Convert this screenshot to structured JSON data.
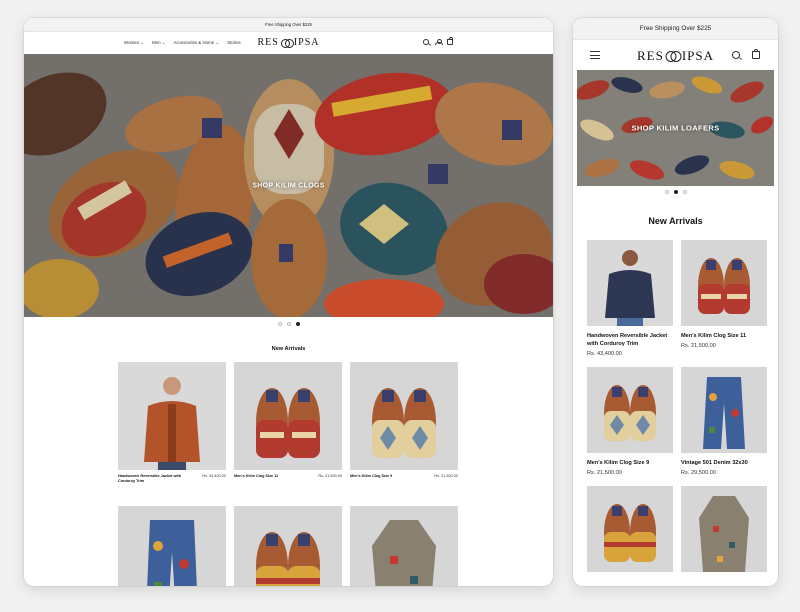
{
  "desktop": {
    "announcement": "Free Shipping Over $225",
    "nav": [
      "Women",
      "Men",
      "Accessories & Home",
      "Stories"
    ],
    "logo": "RES IPSA",
    "hero_label": "SHOP KILIM CLOGS",
    "section_title": "New Arrivals",
    "products": [
      {
        "name": "Handwoven Reversible Jacket with Corduroy Trim",
        "price": "Rs. 43,400.00"
      },
      {
        "name": "Men's Kilim Clog Size 11",
        "price": "Rs. 21,500.00"
      },
      {
        "name": "Men's Kilim Clog Size 9",
        "price": "Rs. 21,500.00"
      },
      {
        "name": "",
        "price": ""
      },
      {
        "name": "",
        "price": ""
      },
      {
        "name": "",
        "price": ""
      }
    ]
  },
  "mobile": {
    "announcement": "Free Shipping Over $225",
    "logo": "RES IPSA",
    "hero_label": "SHOP KILIM LOAFERS",
    "section_title": "New Arrivals",
    "products": [
      {
        "name": "Handwoven Reversible Jacket with Corduroy Trim",
        "price": "Rs. 43,400.00"
      },
      {
        "name": "Men's Kilim Clog Size 11",
        "price": "Rs. 21,500.00"
      },
      {
        "name": "Men's Kilim Clog Size 9",
        "price": "Rs. 21,500.00"
      },
      {
        "name": "Vintage 501 Denim 32x30",
        "price": "Rs. 29,500.00"
      },
      {
        "name": "",
        "price": ""
      },
      {
        "name": "",
        "price": ""
      }
    ]
  },
  "icons": {
    "search": "search-icon",
    "account": "account-icon",
    "cart": "cart-icon",
    "menu": "menu-icon",
    "chevron": "chevron-down-icon"
  },
  "colors": {
    "accent": "#121212",
    "kilim_red": "#b23a2e",
    "kilim_navy": "#2c3550",
    "leather": "#a35a2e",
    "background": "#f1f1f1"
  }
}
